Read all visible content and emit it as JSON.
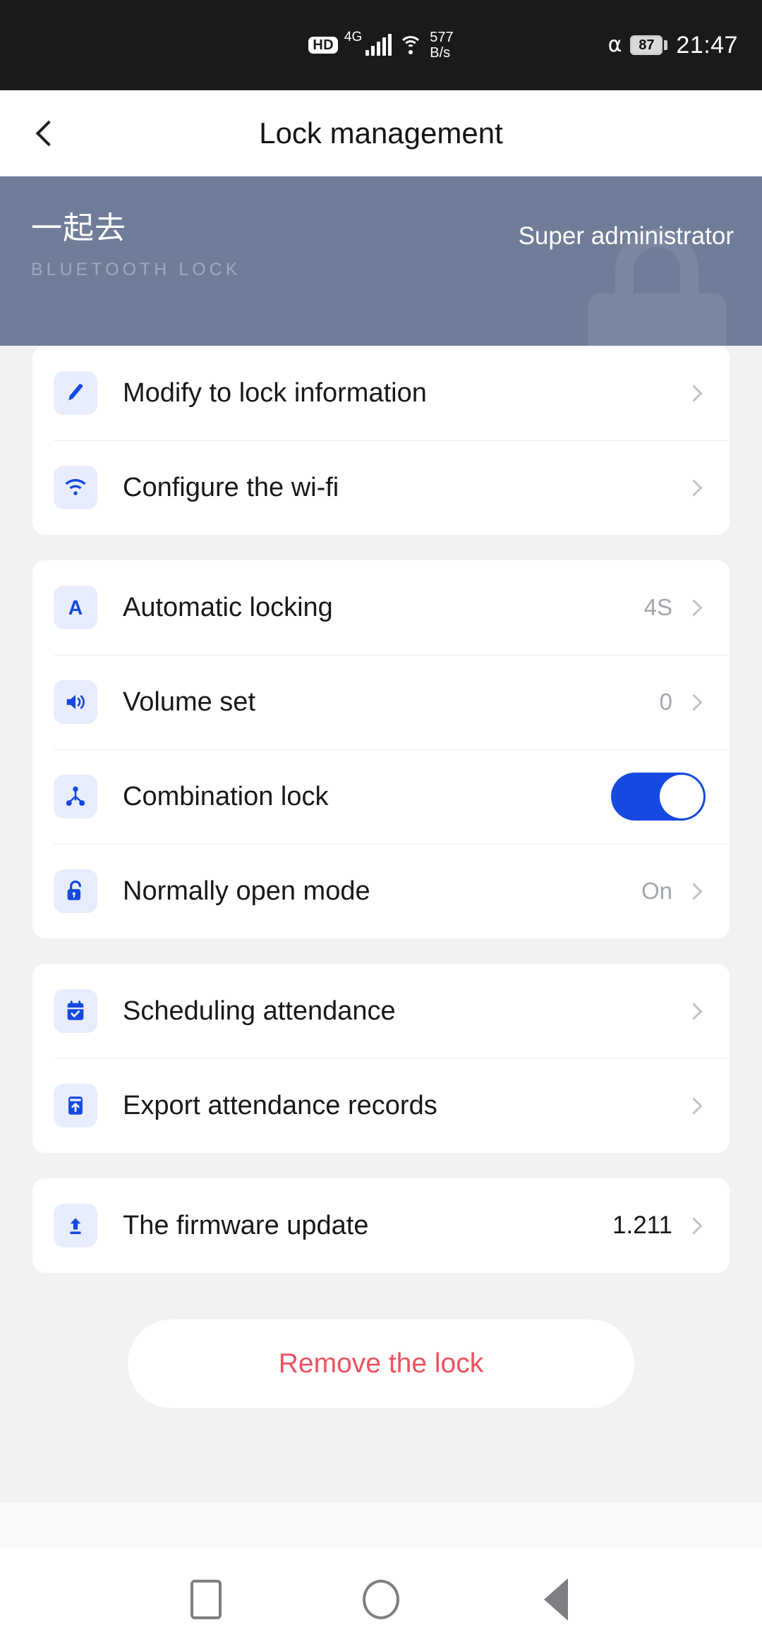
{
  "statusbar": {
    "hd_badge": "HD",
    "network_gen": "4G",
    "speed_value": "577",
    "speed_unit": "B/s",
    "bluetooth_icon": "bluetooth-icon",
    "battery_level": "87",
    "clock": "21:47"
  },
  "header": {
    "back_icon": "chevron-left-icon",
    "title": "Lock management"
  },
  "hero": {
    "device_name": "一起去",
    "device_subtitle": "BLUETOOTH LOCK",
    "role_icon": "shield-key-icon",
    "role_label": "Super administrator",
    "background_color": "#707d99",
    "watermark_icon": "lock-icon"
  },
  "sections": [
    {
      "rows": [
        {
          "icon": "pencil-icon",
          "label": "Modify to lock information",
          "value": "",
          "control": "chevron"
        },
        {
          "icon": "wifi-icon",
          "label": "Configure the wi-fi",
          "value": "",
          "control": "chevron"
        }
      ]
    },
    {
      "rows": [
        {
          "icon": "letter-a-icon",
          "label": "Automatic locking",
          "value": "4S",
          "control": "chevron"
        },
        {
          "icon": "volume-icon",
          "label": "Volume set",
          "value": "0",
          "control": "chevron"
        },
        {
          "icon": "fingerprint-node-icon",
          "label": "Combination lock",
          "value": "",
          "control": "toggle",
          "toggle_on": true
        },
        {
          "icon": "unlocked-padlock-icon",
          "label": "Normally open mode",
          "value": "On",
          "control": "chevron"
        }
      ]
    },
    {
      "rows": [
        {
          "icon": "calendar-check-icon",
          "label": "Scheduling attendance",
          "value": "",
          "control": "chevron"
        },
        {
          "icon": "export-box-icon",
          "label": "Export attendance records",
          "value": "",
          "control": "chevron"
        }
      ]
    },
    {
      "rows": [
        {
          "icon": "upload-arrow-icon",
          "label": "The firmware update",
          "value": "1.211",
          "control": "chevron",
          "value_dark": true
        }
      ]
    }
  ],
  "remove_button": {
    "label": "Remove the lock",
    "color": "#ef5160"
  },
  "navbar": {
    "recents_icon": "square-icon",
    "home_icon": "circle-icon",
    "back_icon": "triangle-left-icon"
  },
  "theme": {
    "accent": "#1549e0",
    "icon_tint": "#1549e0",
    "icon_bg": "#e8edfd",
    "page_bg": "#f2f2f2"
  }
}
